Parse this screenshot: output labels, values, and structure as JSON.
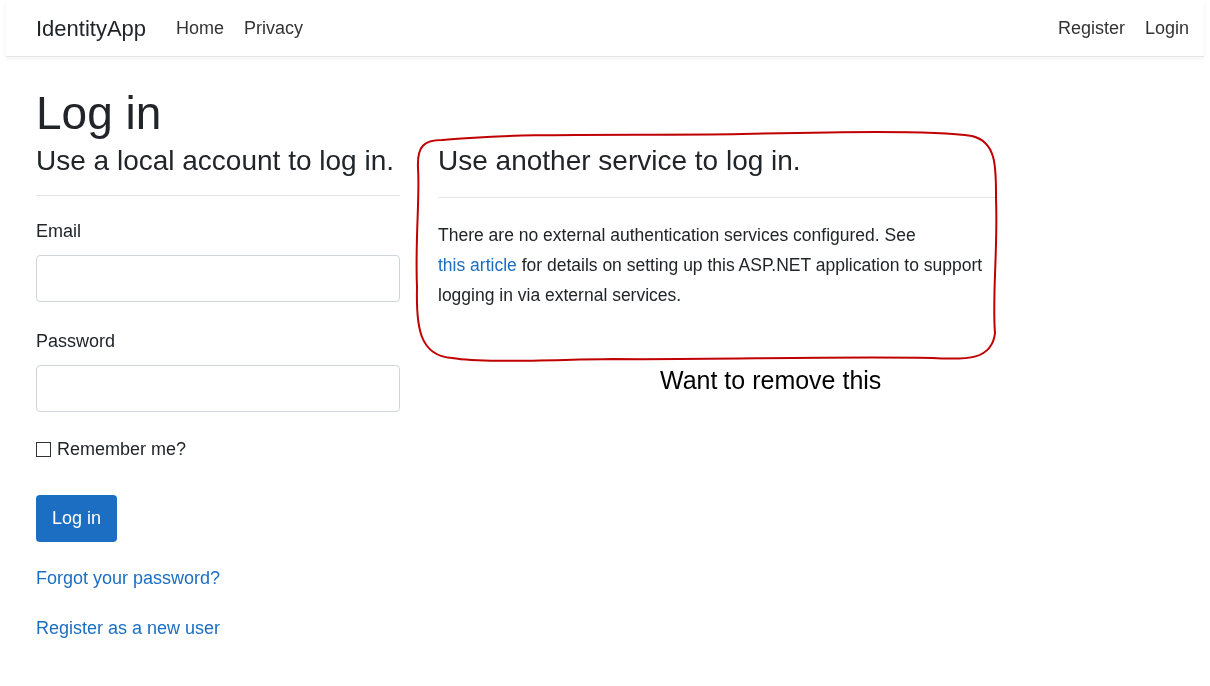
{
  "navbar": {
    "brand": "IdentityApp",
    "links": [
      "Home",
      "Privacy"
    ],
    "right_links": [
      "Register",
      "Login"
    ]
  },
  "title": "Log in",
  "local": {
    "heading": "Use a local account to log in.",
    "email_label": "Email",
    "password_label": "Password",
    "remember_me": {
      "label": "Remember me?",
      "checked": false
    },
    "submit": "Log in",
    "links": [
      "Forgot your password?",
      "Register as a new user"
    ]
  },
  "external": {
    "heading": "Use another service to log in.",
    "text_before": "There are no external authentication services configured. See ",
    "link": "this article",
    "text_after": " for details on setting up this ASP.NET application to support logging in via external services."
  },
  "annotation": {
    "note": "Want to remove this"
  }
}
